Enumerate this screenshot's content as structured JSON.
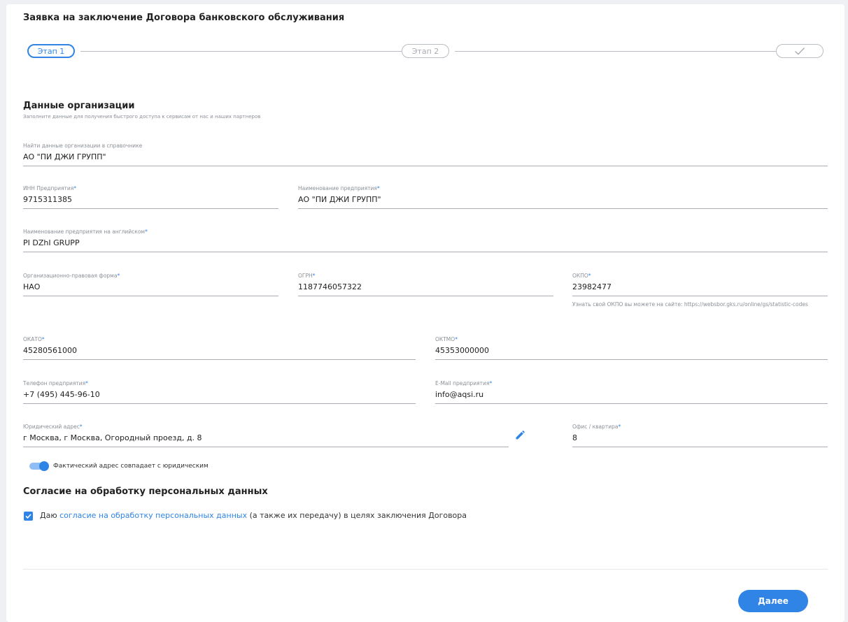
{
  "page_title": "Заявка на заключение Договора банковского обслуживания",
  "stepper": {
    "steps": [
      {
        "label": "Этап 1",
        "state": "active"
      },
      {
        "label": "Этап 2",
        "state": "inactive"
      },
      {
        "label": "",
        "icon": "check-icon",
        "state": "inactive"
      }
    ]
  },
  "section": {
    "title": "Данные организации",
    "subtitle": "Заполните данные для получения быстрого доступа к сервисам от нас и наших партнеров"
  },
  "fields": {
    "directory_search": {
      "label": "Найти данные организации в справочнике",
      "value": "АО \"ПИ ДЖИ ГРУПП\""
    },
    "inn": {
      "label": "ИНН Предприятия",
      "required_mark": "*",
      "value": "9715311385"
    },
    "company_name": {
      "label": "Наименование предприятия",
      "required_mark": "*",
      "value": "АО \"ПИ ДЖИ ГРУПП\""
    },
    "company_name_en": {
      "label": "Наименование предприятия на английском",
      "required_mark": "*",
      "value": "PI DZhI GRUPP"
    },
    "legal_form": {
      "label": "Организационно-правовая форма",
      "required_mark": "*",
      "value": "НАО"
    },
    "ogrn": {
      "label": "ОГРН",
      "required_mark": "*",
      "value": "1187746057322"
    },
    "okpo": {
      "label": "ОКПО",
      "required_mark": "*",
      "value": "23982477",
      "hint": "Узнать свой ОКПО вы можете на сайте: https://websbor.gks.ru/online/gs/statistic-codes"
    },
    "okato": {
      "label": "ОКАТО",
      "required_mark": "*",
      "value": "45280561000"
    },
    "oktmo": {
      "label": "ОКТМО",
      "required_mark": "*",
      "value": "45353000000"
    },
    "phone": {
      "label": "Телефон предприятия",
      "required_mark": "*",
      "value": "+7 (495) 445-96-10"
    },
    "email": {
      "label": "E-Mail предприятия",
      "required_mark": "*",
      "value": "info@aqsi.ru"
    },
    "legal_address": {
      "label": "Юридический адрес",
      "required_mark": "*",
      "value": "г Москва, г Москва, Огородный проезд, д. 8"
    },
    "office": {
      "label": "Офис / квартира",
      "required_mark": "*",
      "value": "8"
    }
  },
  "toggle": {
    "label": "Фактический адрес совпадает с юридическим",
    "checked": true
  },
  "consent": {
    "title": "Согласие на обработку персональных данных",
    "prefix": "Даю ",
    "link": "согласие на обработку персональных данных",
    "suffix": " (а также их передачу) в целях заключения Договора",
    "checked": true
  },
  "next_button": "Далее",
  "colors": {
    "accent": "#2f84e6",
    "line": "#a9adb3",
    "muted": "#8a8f96"
  }
}
